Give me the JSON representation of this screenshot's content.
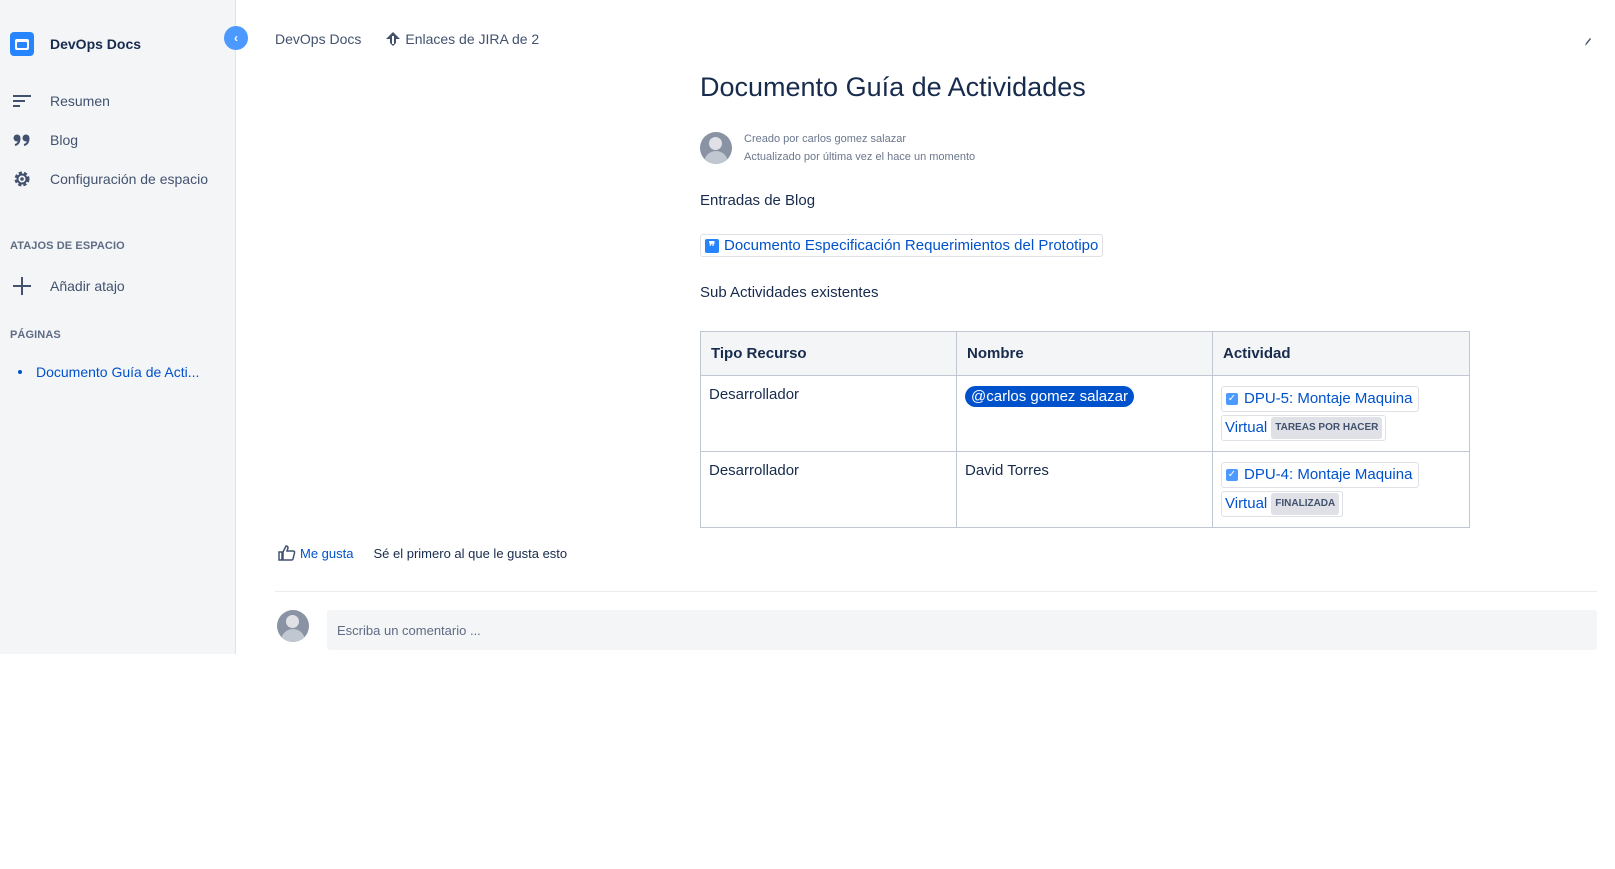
{
  "sidebar": {
    "space_name": "DevOps Docs",
    "collapse_icon": "chevron-left-icon",
    "nav": [
      {
        "label": "Resumen",
        "icon": "overview-icon"
      },
      {
        "label": "Blog",
        "icon": "quote-icon"
      },
      {
        "label": "Configuración de espacio",
        "icon": "gear-icon"
      }
    ],
    "shortcuts_title": "ATAJOS DE ESPACIO",
    "add_shortcut": "Añadir atajo",
    "pages_title": "PÁGINAS",
    "page_tree": [
      "Documento Guía de Acti..."
    ]
  },
  "breadcrumbs": {
    "space": "DevOps Docs",
    "jira_links": "Enlaces de JIRA de 2"
  },
  "page": {
    "title": "Documento Guía de Actividades",
    "created_by": "Creado por carlos gomez salazar",
    "updated": "Actualizado por última vez el hace un momento",
    "blog_heading": "Entradas de Blog",
    "blog_link": "Documento Especificación Requerimientos del Prototipo",
    "sub_heading": "Sub Actividades existentes"
  },
  "table": {
    "headers": [
      "Tipo Recurso",
      "Nombre",
      "Actividad"
    ],
    "rows": [
      {
        "tipo": "Desarrollador",
        "nombre": "@carlos gomez salazar",
        "issue": "DPU-5: Montaje Maquina",
        "issue_cont": "Virtual",
        "status": "TAREAS POR HACER"
      },
      {
        "tipo": "Desarrollador",
        "nombre": "David Torres",
        "issue": "DPU-4: Montaje Maquina",
        "issue_cont": "Virtual",
        "status": "FINALIZADA"
      }
    ]
  },
  "footer": {
    "like_label": "Me gusta",
    "like_text": "Sé el primero al que le gusta esto",
    "comment_placeholder": "Escriba un comentario ..."
  },
  "colors": {
    "accent": "#0052cc",
    "sidebar_bg": "#f4f5f7",
    "mention_bg": "#0052cc",
    "collapse_btn": "#4c9aff"
  }
}
